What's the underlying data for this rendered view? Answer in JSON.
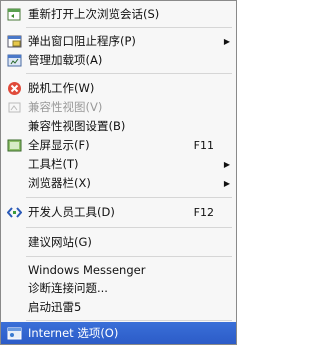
{
  "menu": {
    "items": [
      {
        "label": "重新打开上次浏览会话(S)",
        "shortcut": "",
        "submenu": false,
        "disabled": false,
        "icon": "reopen-session-icon"
      },
      {
        "label": "弹出窗口阻止程序(P)",
        "shortcut": "",
        "submenu": true,
        "disabled": false,
        "icon": "popup-blocker-icon"
      },
      {
        "label": "管理加载项(A)",
        "shortcut": "",
        "submenu": false,
        "disabled": false,
        "icon": "addons-icon"
      },
      {
        "label": "脱机工作(W)",
        "shortcut": "",
        "submenu": false,
        "disabled": false,
        "icon": "offline-icon"
      },
      {
        "label": "兼容性视图(V)",
        "shortcut": "",
        "submenu": false,
        "disabled": true,
        "icon": "compat-view-icon"
      },
      {
        "label": "兼容性视图设置(B)",
        "shortcut": "",
        "submenu": false,
        "disabled": false,
        "icon": ""
      },
      {
        "label": "全屏显示(F)",
        "shortcut": "F11",
        "submenu": false,
        "disabled": false,
        "icon": "fullscreen-icon"
      },
      {
        "label": "工具栏(T)",
        "shortcut": "",
        "submenu": true,
        "disabled": false,
        "icon": ""
      },
      {
        "label": "浏览器栏(X)",
        "shortcut": "",
        "submenu": true,
        "disabled": false,
        "icon": ""
      },
      {
        "label": "开发人员工具(D)",
        "shortcut": "F12",
        "submenu": false,
        "disabled": false,
        "icon": "developer-tools-icon"
      },
      {
        "label": "建议网站(G)",
        "shortcut": "",
        "submenu": false,
        "disabled": false,
        "icon": ""
      },
      {
        "label": "Windows Messenger",
        "shortcut": "",
        "submenu": false,
        "disabled": false,
        "icon": ""
      },
      {
        "label": "诊断连接问题...",
        "shortcut": "",
        "submenu": false,
        "disabled": false,
        "icon": ""
      },
      {
        "label": "启动迅雷5",
        "shortcut": "",
        "submenu": false,
        "disabled": false,
        "icon": ""
      },
      {
        "label": "Internet 选项(O)",
        "shortcut": "",
        "submenu": false,
        "disabled": false,
        "highlighted": true,
        "icon": "internet-options-icon"
      }
    ]
  },
  "colors": {
    "highlight": "#2c5cc8",
    "background": "#f7f7f7",
    "separator": "#d6d6d6",
    "disabled": "#9a9a9a"
  }
}
